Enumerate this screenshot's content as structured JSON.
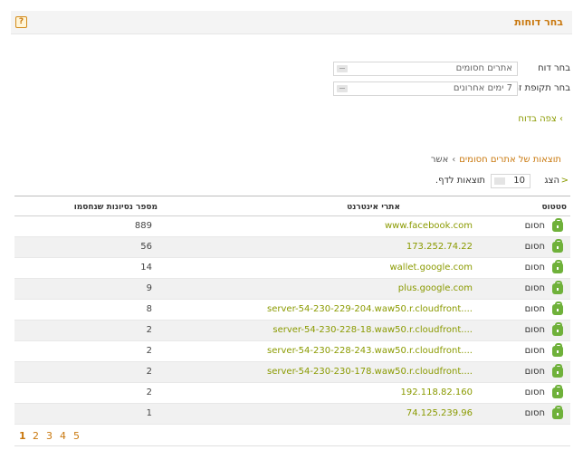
{
  "header": {
    "title": "בחר דוחות",
    "help_icon": "?"
  },
  "form": {
    "report_label": "בחר דוח",
    "report_value": "אתרים חסומים",
    "period_label": "בחר תקופת זמן",
    "period_value": "7 ימים אחרונים"
  },
  "view_report": "› צפה בדוח",
  "results": {
    "title": "תוצאות של אתרים חסומים",
    "sep": "›",
    "confirm": "אשר"
  },
  "perpage": {
    "show_label": "הצג",
    "value": "10",
    "suffix": "תוצאות לדף.",
    "arrow": "<"
  },
  "table": {
    "headers": {
      "status": "סטטוס",
      "site": "אתרי אינטרנט",
      "count": "מספר נסיונות שנחסמו"
    },
    "rows": [
      {
        "status": "חסום",
        "site": "www.facebook.com",
        "count": "889"
      },
      {
        "status": "חסום",
        "site": "173.252.74.22",
        "count": "56"
      },
      {
        "status": "חסום",
        "site": "wallet.google.com",
        "count": "14"
      },
      {
        "status": "חסום",
        "site": "plus.google.com",
        "count": "9"
      },
      {
        "status": "חסום",
        "site": "server-54-230-229-204.waw50.r.cloudfront....",
        "count": "8"
      },
      {
        "status": "חסום",
        "site": "server-54-230-228-18.waw50.r.cloudfront....",
        "count": "2"
      },
      {
        "status": "חסום",
        "site": "server-54-230-228-243.waw50.r.cloudfront....",
        "count": "2"
      },
      {
        "status": "חסום",
        "site": "server-54-230-230-178.waw50.r.cloudfront....",
        "count": "2"
      },
      {
        "status": "חסום",
        "site": "192.118.82.160",
        "count": "2"
      },
      {
        "status": "חסום",
        "site": "74.125.239.96",
        "count": "1"
      }
    ]
  },
  "pager": {
    "pages": [
      "1",
      "2",
      "3",
      "4",
      "5"
    ],
    "current": "1"
  },
  "colors": {
    "accent": "#c9780e",
    "link": "#8a9a00",
    "lock": "#6fb13a"
  },
  "icons": {
    "help": "help-icon",
    "lock": "lock-icon",
    "dropdown": "dropdown-arrow-icon"
  }
}
